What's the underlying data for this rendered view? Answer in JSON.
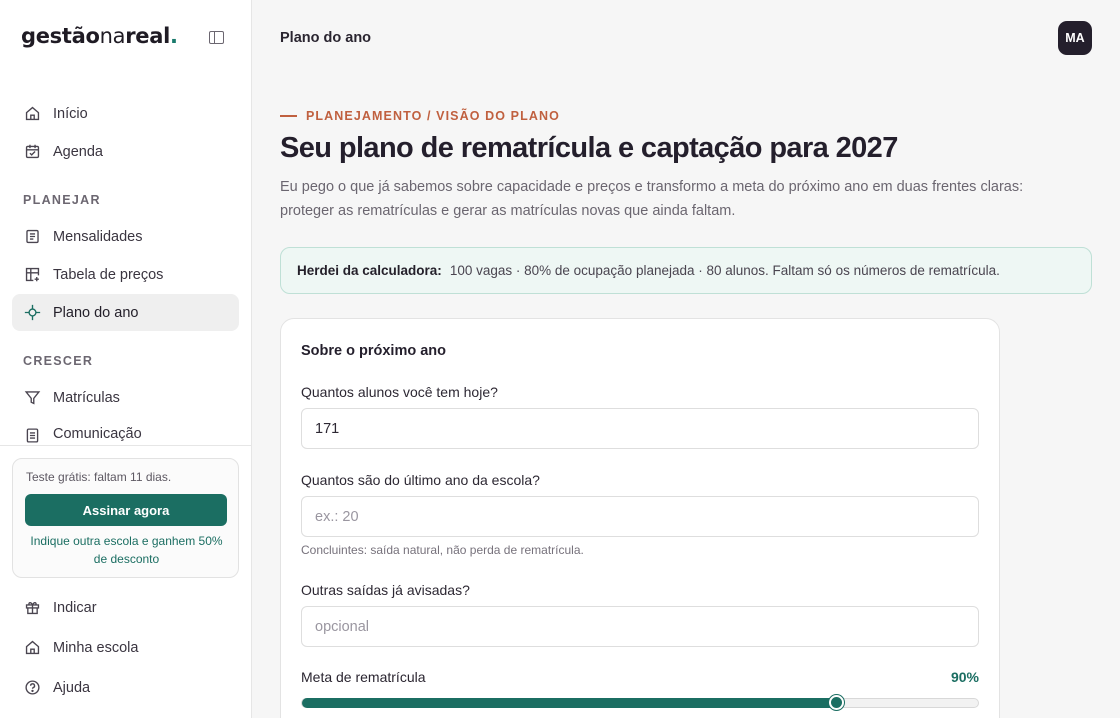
{
  "brand": {
    "part1": "gestão",
    "part2": "na",
    "part3": "real",
    "dot": "."
  },
  "sidebar": {
    "top_items": [
      {
        "label": "Início",
        "icon": "home-icon"
      },
      {
        "label": "Agenda",
        "icon": "calendar-icon"
      }
    ],
    "sections": [
      {
        "title": "PLANEJAR",
        "items": [
          {
            "label": "Mensalidades",
            "icon": "receipt-icon"
          },
          {
            "label": "Tabela de preços",
            "icon": "table-add-icon"
          },
          {
            "label": "Plano do ano",
            "icon": "target-icon",
            "active": true
          }
        ]
      },
      {
        "title": "CRESCER",
        "items": [
          {
            "label": "Matrículas",
            "icon": "funnel-icon"
          },
          {
            "label": "Comunicação",
            "icon": "document-icon"
          }
        ]
      }
    ],
    "trial": {
      "text": "Teste grátis: faltam 11 dias.",
      "button": "Assinar agora",
      "refer": "Indique outra escola e ganhem 50% de desconto"
    },
    "bottom_items": [
      {
        "label": "Indicar",
        "icon": "gift-icon"
      },
      {
        "label": "Minha escola",
        "icon": "school-icon"
      },
      {
        "label": "Ajuda",
        "icon": "help-icon"
      }
    ]
  },
  "topbar": {
    "title": "Plano do ano",
    "avatar": "MA"
  },
  "main": {
    "eyebrow": "PLANEJAMENTO / VISÃO DO PLANO",
    "title": "Seu plano de rematrícula e captação para 2027",
    "subtitle": "Eu pego o que já sabemos sobre capacidade e preços e transformo a meta do próximo ano em duas frentes claras: proteger as rematrículas e gerar as matrículas novas que ainda faltam.",
    "banner": {
      "strong": "Herdei da calculadora:",
      "text": "100 vagas · 80% de ocupação planejada · 80 alunos. Faltam só os números de rematrícula."
    },
    "card": {
      "title": "Sobre o próximo ano",
      "q1": {
        "label": "Quantos alunos você tem hoje?",
        "value": "171",
        "placeholder": ""
      },
      "q2": {
        "label": "Quantos são do último ano da escola?",
        "value": "",
        "placeholder": "ex.: 20",
        "hint": "Concluintes: saída natural, não perda de rematrícula."
      },
      "q3": {
        "label": "Outras saídas já avisadas?",
        "value": "",
        "placeholder": "opcional"
      },
      "meta": {
        "label": "Meta de rematrícula",
        "percent_text": "90%",
        "slider_fraction": 0.79
      }
    }
  },
  "colors": {
    "accent": "#1b6e62",
    "eyebrow": "#c0603f",
    "banner_bg": "#eef7f4"
  }
}
